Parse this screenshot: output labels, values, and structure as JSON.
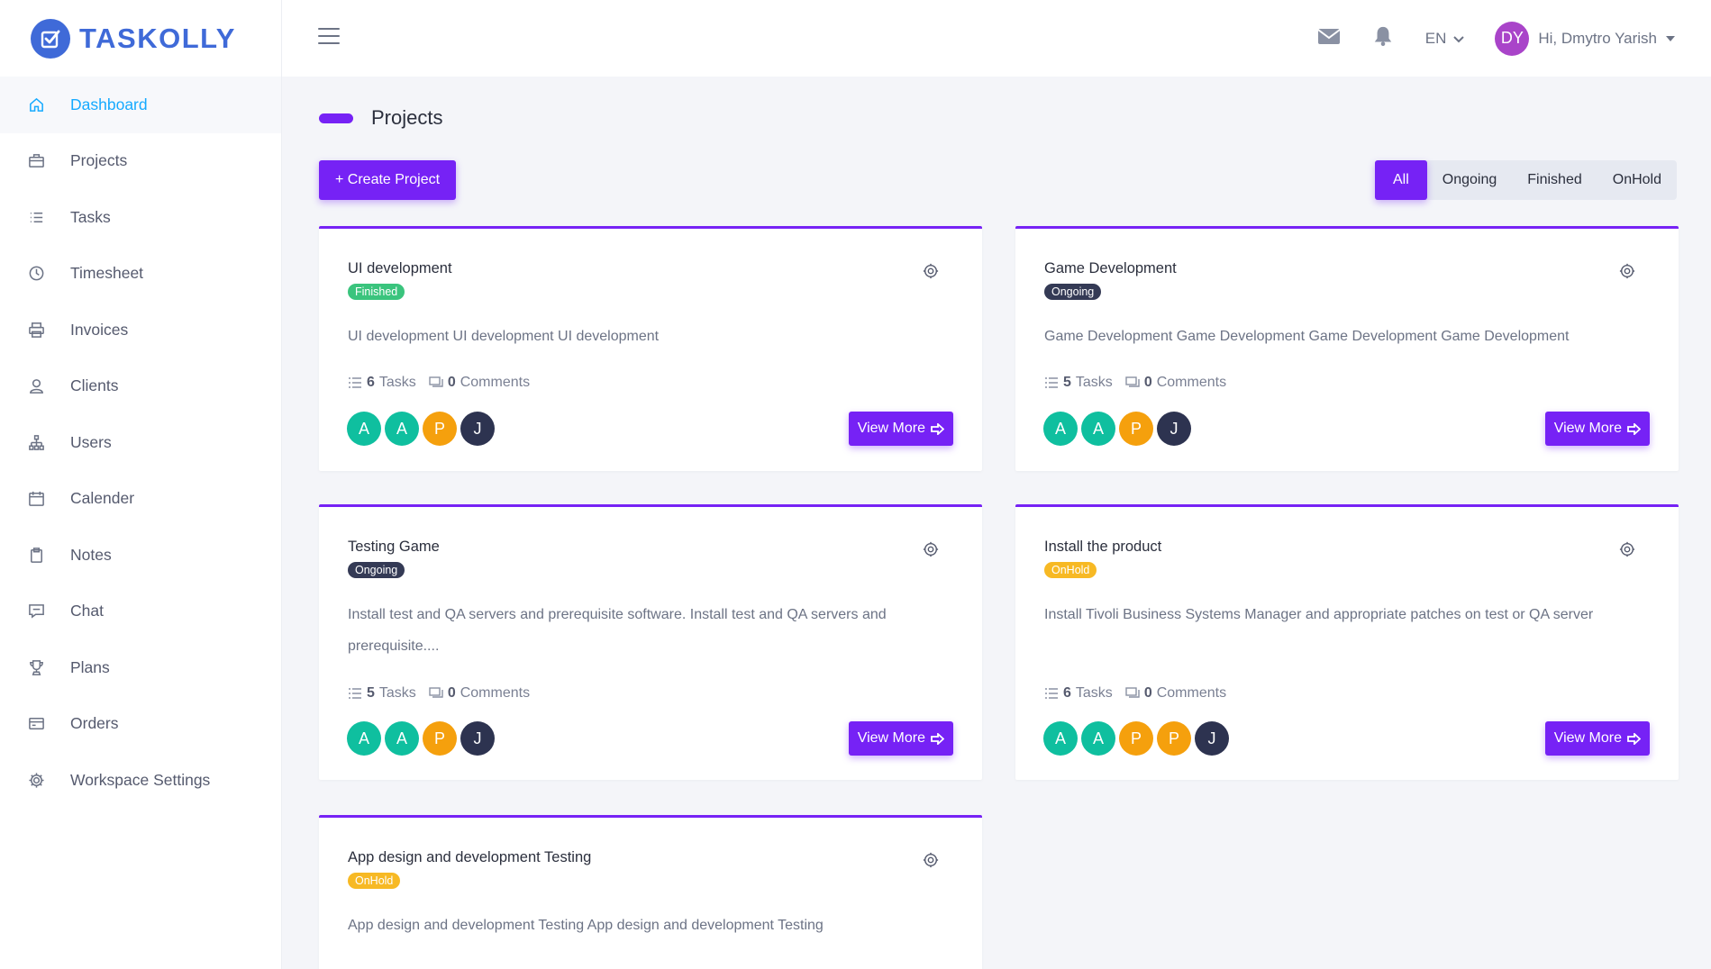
{
  "brand": {
    "name": "TASKOLLY"
  },
  "sidebar": {
    "items": [
      {
        "label": "Dashboard",
        "icon": "home-icon",
        "active": true
      },
      {
        "label": "Projects",
        "icon": "briefcase-icon"
      },
      {
        "label": "Tasks",
        "icon": "list-icon"
      },
      {
        "label": "Timesheet",
        "icon": "clock-icon"
      },
      {
        "label": "Invoices",
        "icon": "printer-icon"
      },
      {
        "label": "Clients",
        "icon": "user-icon"
      },
      {
        "label": "Users",
        "icon": "sitemap-icon"
      },
      {
        "label": "Calender",
        "icon": "calendar-icon"
      },
      {
        "label": "Notes",
        "icon": "clipboard-icon"
      },
      {
        "label": "Chat",
        "icon": "chat-icon"
      },
      {
        "label": "Plans",
        "icon": "trophy-icon"
      },
      {
        "label": "Orders",
        "icon": "credit-card-icon"
      },
      {
        "label": "Workspace Settings",
        "icon": "gear-icon"
      }
    ]
  },
  "header": {
    "language": "EN",
    "user_initials": "DY",
    "user_greeting": "Hi, Dmytro Yarish"
  },
  "main": {
    "title": "Projects",
    "create_label": "+ Create Project",
    "filters": [
      "All",
      "Ongoing",
      "Finished",
      "OnHold"
    ],
    "active_filter": "All",
    "view_more_label": "View More",
    "projects": [
      {
        "title": "UI development",
        "status": "Finished",
        "status_kind": "finished",
        "description": "UI development UI development UI development",
        "tasks_count": "6",
        "tasks_label": "Tasks",
        "comments_count": "0",
        "comments_label": "Comments",
        "members": [
          "A",
          "A",
          "P",
          "J"
        ],
        "member_colors": [
          "teal",
          "teal",
          "orange",
          "dark"
        ]
      },
      {
        "title": "Game Development",
        "status": "Ongoing",
        "status_kind": "ongoing",
        "description": "Game Development Game Development Game Development Game Development",
        "tasks_count": "5",
        "tasks_label": "Tasks",
        "comments_count": "0",
        "comments_label": "Comments",
        "members": [
          "A",
          "A",
          "P",
          "J"
        ],
        "member_colors": [
          "teal",
          "teal",
          "orange",
          "dark"
        ]
      },
      {
        "title": "Testing Game",
        "status": "Ongoing",
        "status_kind": "ongoing",
        "description": "Install test and QA servers and prerequisite software. Install test and QA servers and prerequisite....",
        "tasks_count": "5",
        "tasks_label": "Tasks",
        "comments_count": "0",
        "comments_label": "Comments",
        "members": [
          "A",
          "A",
          "P",
          "J"
        ],
        "member_colors": [
          "teal",
          "teal",
          "orange",
          "dark"
        ]
      },
      {
        "title": "Install the product",
        "status": "OnHold",
        "status_kind": "onhold",
        "description": "Install Tivoli Business Systems Manager and appropriate patches on test or QA server",
        "tasks_count": "6",
        "tasks_label": "Tasks",
        "comments_count": "0",
        "comments_label": "Comments",
        "members": [
          "A",
          "A",
          "P",
          "P",
          "J"
        ],
        "member_colors": [
          "teal",
          "teal",
          "orange",
          "orange",
          "dark"
        ]
      },
      {
        "title": "App design and development Testing",
        "status": "OnHold",
        "status_kind": "onhold",
        "description": "App design and development Testing App design and development Testing"
      }
    ]
  },
  "colors": {
    "accent": "#7622f5",
    "brand": "#3f6ad8",
    "active_nav": "#16aaff",
    "finished": "#3ac47d",
    "ongoing": "#343a55",
    "onhold": "#f7b924"
  }
}
